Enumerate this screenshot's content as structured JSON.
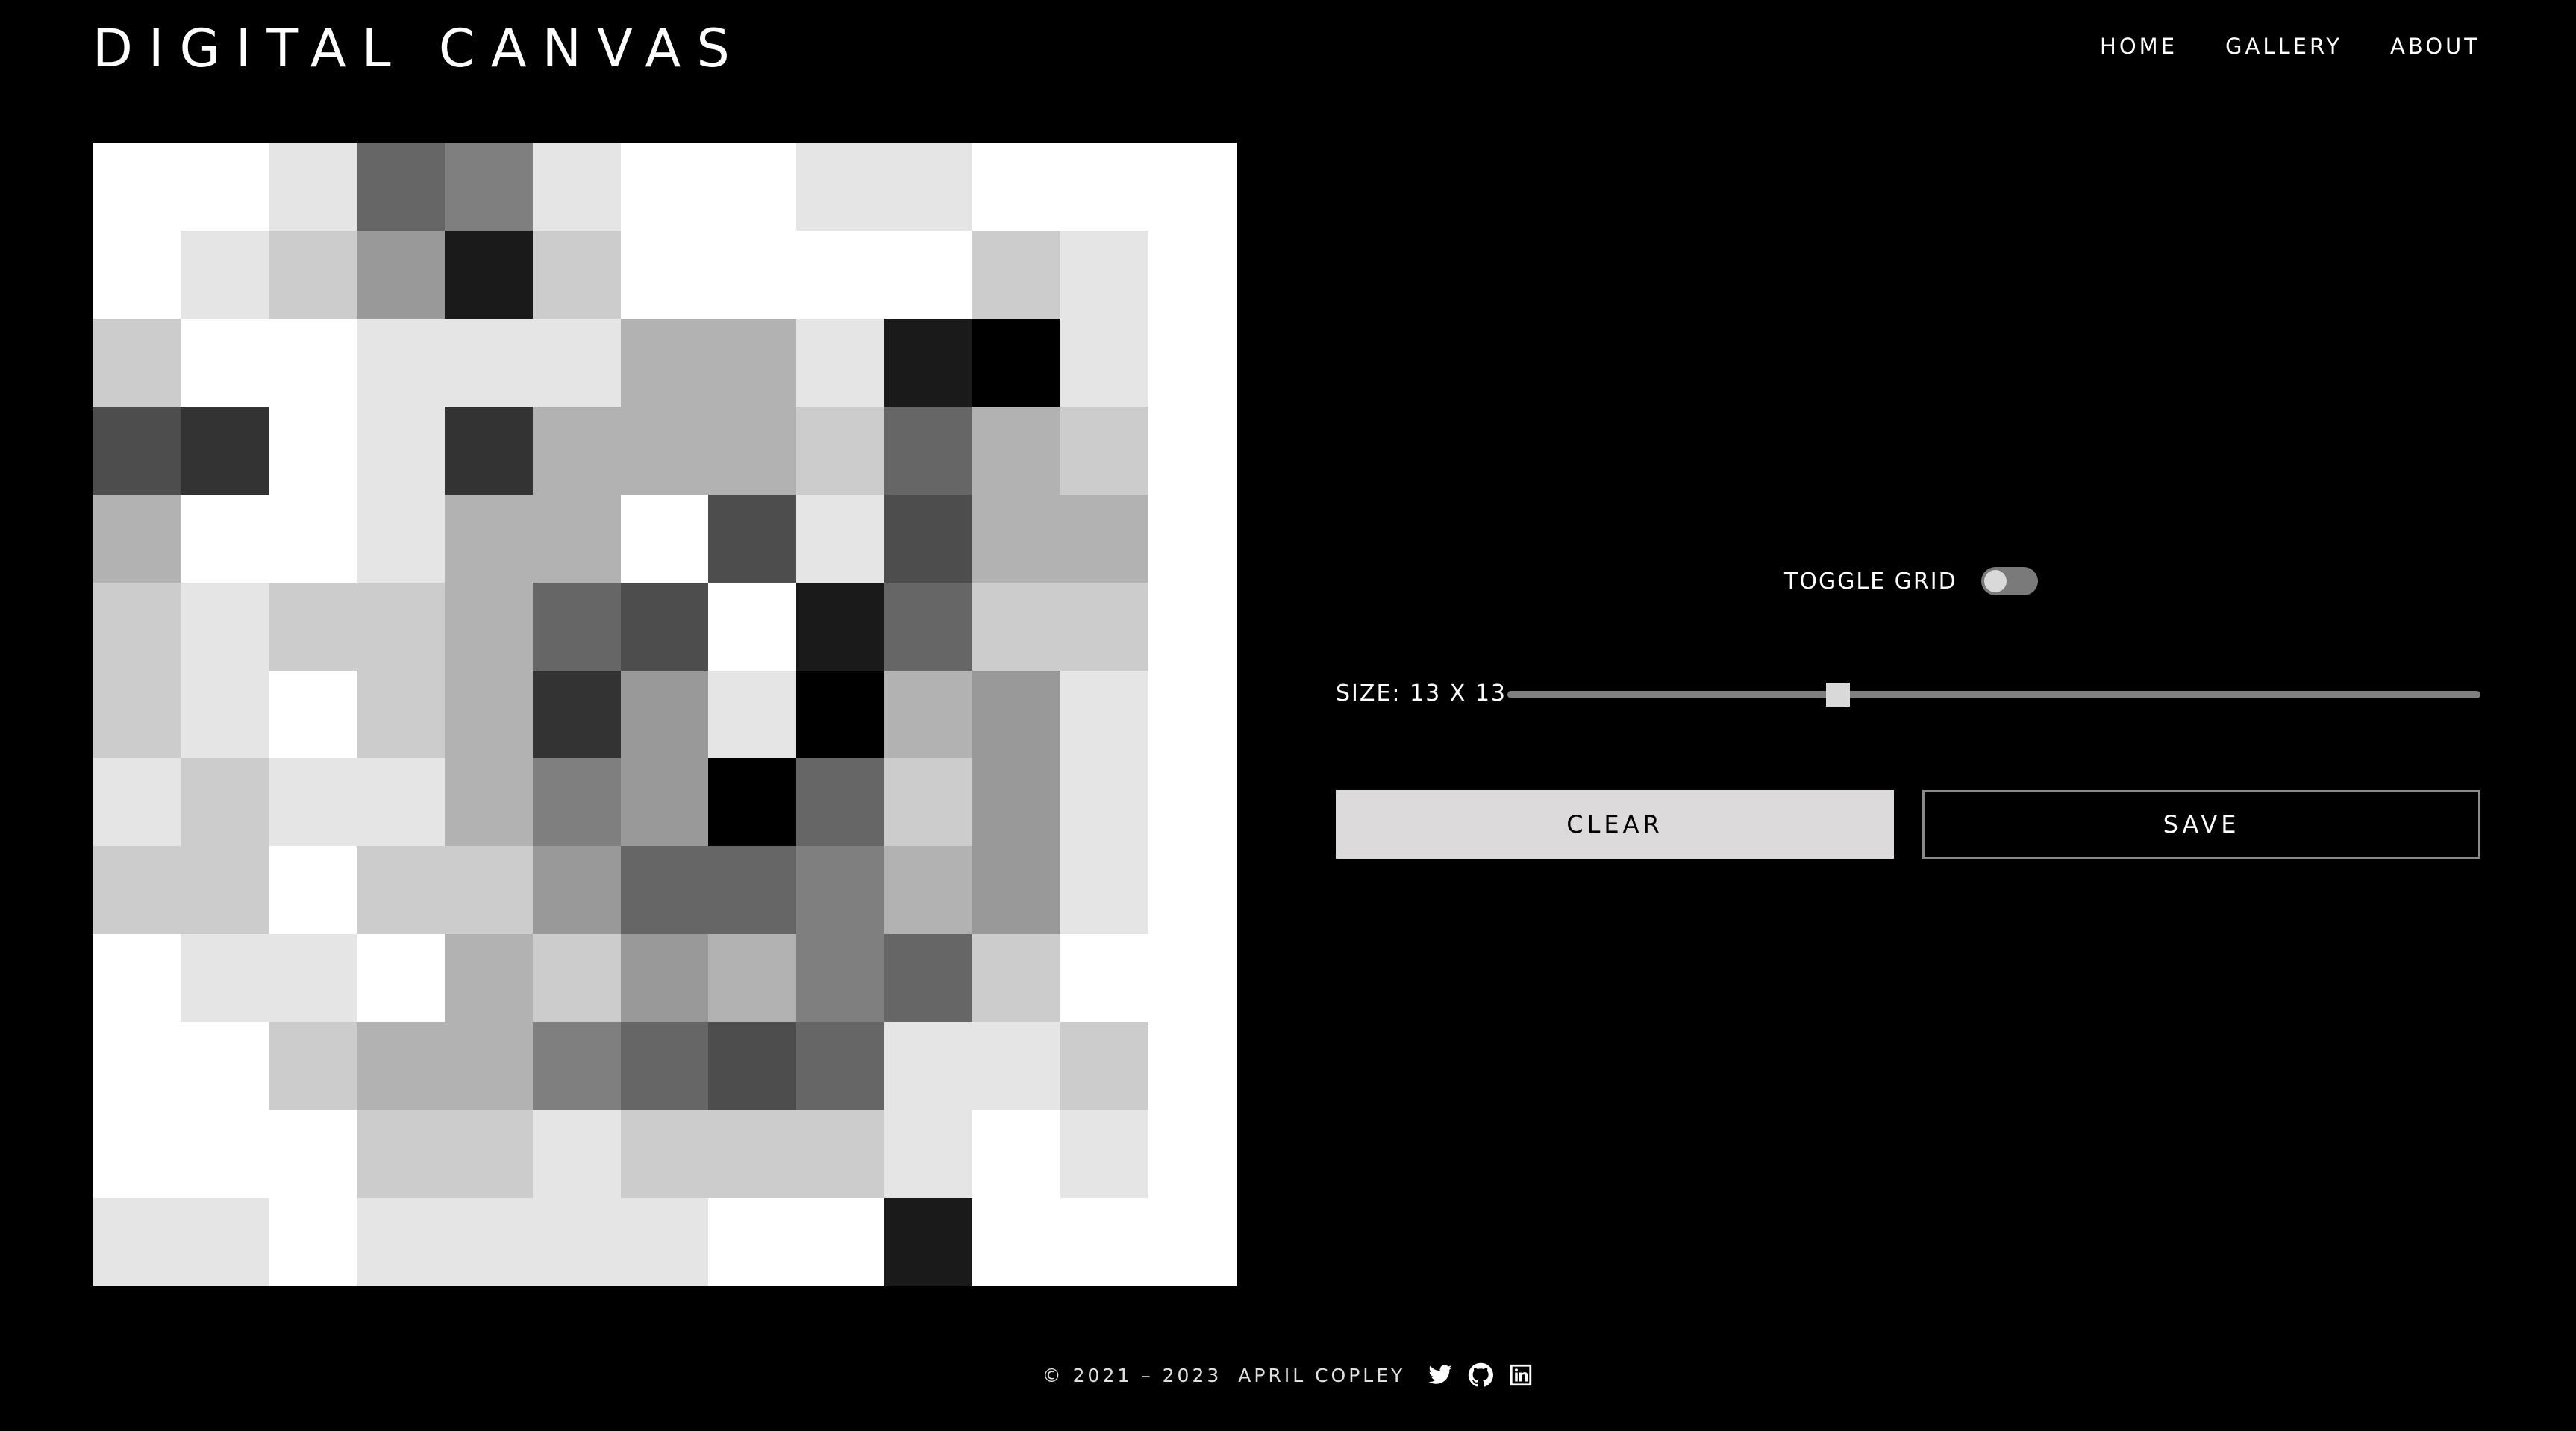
{
  "header": {
    "title": "DIGITAL CANVAS",
    "nav": [
      {
        "label": "HOME"
      },
      {
        "label": "GALLERY"
      },
      {
        "label": "ABOUT"
      }
    ]
  },
  "canvas": {
    "rows": 13,
    "cols": 13,
    "pixels": [
      [
        "#ffffff",
        "#ffffff",
        "#e5e5e5",
        "#666666",
        "#7f7f7f",
        "#e5e5e5",
        "#ffffff",
        "#ffffff",
        "#e5e5e5",
        "#e5e5e5",
        "#ffffff",
        "#ffffff",
        "#ffffff"
      ],
      [
        "#ffffff",
        "#e5e5e5",
        "#cccccc",
        "#999999",
        "#1a1a1a",
        "#cccccc",
        "#ffffff",
        "#ffffff",
        "#ffffff",
        "#ffffff",
        "#cccccc",
        "#e5e5e5",
        "#ffffff"
      ],
      [
        "#cccccc",
        "#ffffff",
        "#ffffff",
        "#e5e5e5",
        "#e5e5e5",
        "#e5e5e5",
        "#b2b2b2",
        "#b2b2b2",
        "#e5e5e5",
        "#1a1a1a",
        "#000000",
        "#e5e5e5",
        "#ffffff"
      ],
      [
        "#4d4d4d",
        "#333333",
        "#ffffff",
        "#e5e5e5",
        "#333333",
        "#b2b2b2",
        "#b2b2b2",
        "#b2b2b2",
        "#cccccc",
        "#666666",
        "#b2b2b2",
        "#cccccc",
        "#ffffff"
      ],
      [
        "#b2b2b2",
        "#ffffff",
        "#ffffff",
        "#e5e5e5",
        "#b2b2b2",
        "#b2b2b2",
        "#ffffff",
        "#4d4d4d",
        "#e5e5e5",
        "#4d4d4d",
        "#b2b2b2",
        "#b2b2b2",
        "#ffffff"
      ],
      [
        "#cccccc",
        "#e5e5e5",
        "#cccccc",
        "#cccccc",
        "#b2b2b2",
        "#666666",
        "#4d4d4d",
        "#ffffff",
        "#1a1a1a",
        "#666666",
        "#cccccc",
        "#cccccc",
        "#ffffff"
      ],
      [
        "#cccccc",
        "#e5e5e5",
        "#ffffff",
        "#cccccc",
        "#b2b2b2",
        "#333333",
        "#999999",
        "#e5e5e5",
        "#000000",
        "#b2b2b2",
        "#999999",
        "#e5e5e5",
        "#ffffff"
      ],
      [
        "#e5e5e5",
        "#cccccc",
        "#e5e5e5",
        "#e5e5e5",
        "#b2b2b2",
        "#7f7f7f",
        "#999999",
        "#000000",
        "#666666",
        "#cccccc",
        "#999999",
        "#e5e5e5",
        "#ffffff"
      ],
      [
        "#cccccc",
        "#cccccc",
        "#ffffff",
        "#cccccc",
        "#cccccc",
        "#999999",
        "#666666",
        "#666666",
        "#7f7f7f",
        "#b2b2b2",
        "#999999",
        "#e5e5e5",
        "#ffffff"
      ],
      [
        "#ffffff",
        "#e5e5e5",
        "#e5e5e5",
        "#ffffff",
        "#b2b2b2",
        "#cccccc",
        "#999999",
        "#b2b2b2",
        "#7f7f7f",
        "#666666",
        "#cccccc",
        "#ffffff",
        "#ffffff"
      ],
      [
        "#ffffff",
        "#ffffff",
        "#cccccc",
        "#b2b2b2",
        "#b2b2b2",
        "#7f7f7f",
        "#666666",
        "#4d4d4d",
        "#666666",
        "#e5e5e5",
        "#e5e5e5",
        "#cccccc",
        "#ffffff"
      ],
      [
        "#ffffff",
        "#ffffff",
        "#ffffff",
        "#cccccc",
        "#cccccc",
        "#e5e5e5",
        "#cccccc",
        "#cccccc",
        "#cccccc",
        "#e5e5e5",
        "#ffffff",
        "#e5e5e5",
        "#ffffff"
      ],
      [
        "#e5e5e5",
        "#e5e5e5",
        "#ffffff",
        "#e5e5e5",
        "#e5e5e5",
        "#e5e5e5",
        "#e5e5e5",
        "#ffffff",
        "#ffffff",
        "#1a1a1a",
        "#ffffff",
        "#ffffff",
        "#ffffff"
      ]
    ]
  },
  "controls": {
    "toggle_grid_label": "TOGGLE GRID",
    "toggle_grid_on": false,
    "size_label": "SIZE: 13 X 13",
    "size_slider_fraction": 0.34,
    "clear_label": "CLEAR",
    "save_label": "SAVE"
  },
  "footer": {
    "copyright": "© 2021 – 2023",
    "author": "APRIL COPLEY",
    "icons": [
      "twitter-icon",
      "github-icon",
      "linkedin-icon"
    ]
  },
  "colors": {
    "background": "#000000",
    "clear_button": "#dcdadb",
    "save_border": "#8a8a8a",
    "slider_track": "#7f7f7f"
  }
}
